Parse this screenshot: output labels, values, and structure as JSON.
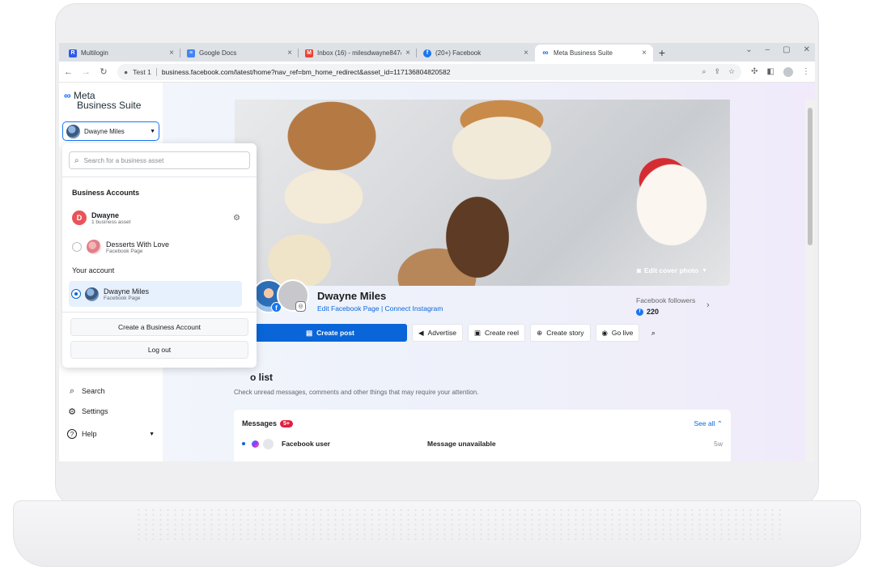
{
  "browser": {
    "tabs": [
      {
        "title": "Multilogin",
        "favicon_color": "#2f5bea",
        "favicon_glyph": "R"
      },
      {
        "title": "Google Docs",
        "favicon_color": "#4285f4",
        "favicon_glyph": "≡"
      },
      {
        "title": "Inbox (16) - milesdwayne847@",
        "favicon_color": "#ea4335",
        "favicon_glyph": "M"
      },
      {
        "title": "(20+) Facebook",
        "favicon_color": "#1877f2",
        "favicon_glyph": "f"
      },
      {
        "title": "Meta Business Suite",
        "favicon_color": "#0866ff",
        "favicon_glyph": "∞"
      }
    ],
    "new_tab": "+",
    "profile_label": "Test 1",
    "url": "business.facebook.com/latest/home?nav_ref=bm_home_redirect&asset_id=117136804820582"
  },
  "sidebar": {
    "logo_line1": "Meta",
    "logo_line2": "Business Suite",
    "account_name": "Dwayne Miles",
    "items": [
      {
        "label": "Search",
        "icon": "search-icon",
        "glyph": "⌕"
      },
      {
        "label": "Settings",
        "icon": "gear-icon",
        "glyph": "⚙"
      },
      {
        "label": "Help",
        "icon": "help-icon",
        "glyph": "?"
      }
    ]
  },
  "dropdown": {
    "search_placeholder": "Search for a business asset",
    "business_accounts_heading": "Business Accounts",
    "business_account": {
      "initial": "D",
      "name": "Dwayne",
      "sub": "1 business asset"
    },
    "page_item": {
      "name": "Desserts With Love",
      "sub": "Facebook Page"
    },
    "your_account_heading": "Your account",
    "your_account": {
      "name": "Dwayne Miles",
      "sub": "Facebook Page"
    },
    "create_button": "Create a Business Account",
    "logout_button": "Log out"
  },
  "profile": {
    "edit_cover": "Edit cover photo",
    "name": "Dwayne Miles",
    "edit_page_link": "Edit Facebook Page",
    "link_separator": "|",
    "connect_instagram_link": "Connect Instagram",
    "followers_label": "Facebook followers",
    "followers_count": "220"
  },
  "actions": {
    "create_post": "Create post",
    "advertise": "Advertise",
    "create_reel": "Create reel",
    "create_story": "Create story",
    "go_live": "Go live"
  },
  "todo": {
    "title": "o list",
    "subtitle": "Check unread messages, comments and other things that may require your attention."
  },
  "messages": {
    "title": "Messages",
    "badge": "5+",
    "see_all": "See all",
    "rows": [
      {
        "name": "Facebook user",
        "text": "Message unavailable",
        "time": "5w"
      }
    ]
  }
}
